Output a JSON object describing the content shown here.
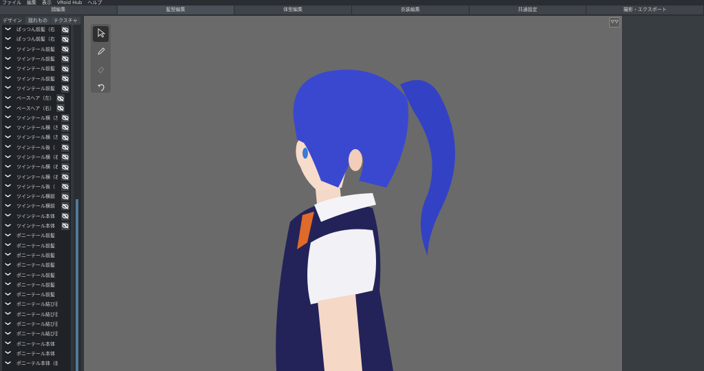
{
  "menu": [
    "ファイル",
    "編集",
    "表示",
    "VRoid Hub",
    "ヘルプ"
  ],
  "tabs": [
    "顔編集",
    "髪型編集",
    "体型編集",
    "衣装編集",
    "共通設定",
    "撮影・エクスポート"
  ],
  "active_tab": 1,
  "subtabs": [
    "デザイン",
    "揺れもの",
    "テクスチャ"
  ],
  "hair_list": [
    {
      "label": "ぱっつん前髪（右",
      "visibility": "hidden"
    },
    {
      "label": "ぱっつん前髪（右",
      "visibility": "hidden"
    },
    {
      "label": "ツインテール前髪（",
      "visibility": "hidden"
    },
    {
      "label": "ツインテール前髪（",
      "visibility": "hidden"
    },
    {
      "label": "ツインテール前髪（",
      "visibility": "hidden"
    },
    {
      "label": "ツインテール前髪（",
      "visibility": "hidden"
    },
    {
      "label": "ツインテール前髪（",
      "visibility": "hidden"
    },
    {
      "label": "ベースヘア（左）",
      "visibility": "hidden-shift"
    },
    {
      "label": "ベースヘア（右）",
      "visibility": "hidden-shift"
    },
    {
      "label": "ツインテール横（左",
      "visibility": "hidden"
    },
    {
      "label": "ツインテール横（左",
      "visibility": "hidden"
    },
    {
      "label": "ツインテール横（左",
      "visibility": "hidden"
    },
    {
      "label": "ツインテール後（",
      "visibility": "hidden"
    },
    {
      "label": "ツインテール横（右",
      "visibility": "hidden"
    },
    {
      "label": "ツインテール横（右",
      "visibility": "hidden"
    },
    {
      "label": "ツインテール横（右",
      "visibility": "hidden"
    },
    {
      "label": "ツインテール後（",
      "visibility": "hidden"
    },
    {
      "label": "ツインテール横前（",
      "visibility": "hidden"
    },
    {
      "label": "ツインテール横前（",
      "visibility": "hidden"
    },
    {
      "label": "ツインテール本体（",
      "visibility": "hidden"
    },
    {
      "label": "ツインテール本体（",
      "visibility": "hidden"
    },
    {
      "label": "ポニーテール前髪（前）",
      "visibility": "visible"
    },
    {
      "label": "ポニーテール前髪（左前",
      "visibility": "visible"
    },
    {
      "label": "ポニーテール前髪（右前",
      "visibility": "visible"
    },
    {
      "label": "ポニーテール前髪（左中",
      "visibility": "visible"
    },
    {
      "label": "ポニーテール前髪（右中",
      "visibility": "visible"
    },
    {
      "label": "ポニーテール前髪（左後",
      "visibility": "visible"
    },
    {
      "label": "ポニーテール前髪（右後",
      "visibility": "visible"
    },
    {
      "label": "ポニーテール結び目（前",
      "visibility": "visible"
    },
    {
      "label": "ポニーテール結び目（後",
      "visibility": "visible"
    },
    {
      "label": "ポニーテール結び目（左",
      "visibility": "visible"
    },
    {
      "label": "ポニーテール結び目（右",
      "visibility": "visible"
    },
    {
      "label": "ポニーテール本体（中）",
      "visibility": "visible"
    },
    {
      "label": "ポニーテール本体（後）",
      "visibility": "visible"
    },
    {
      "label": "ポニーテル本体（前）",
      "visibility": "visible"
    }
  ],
  "tools": [
    "select-arrow-icon",
    "pen-icon",
    "eraser-icon",
    "undo-icon"
  ],
  "colors": {
    "hair": "#3a48d0",
    "vest": "#23235a",
    "viewport": "#6a6a6a",
    "scroll_thumb": "#4f7a99"
  }
}
